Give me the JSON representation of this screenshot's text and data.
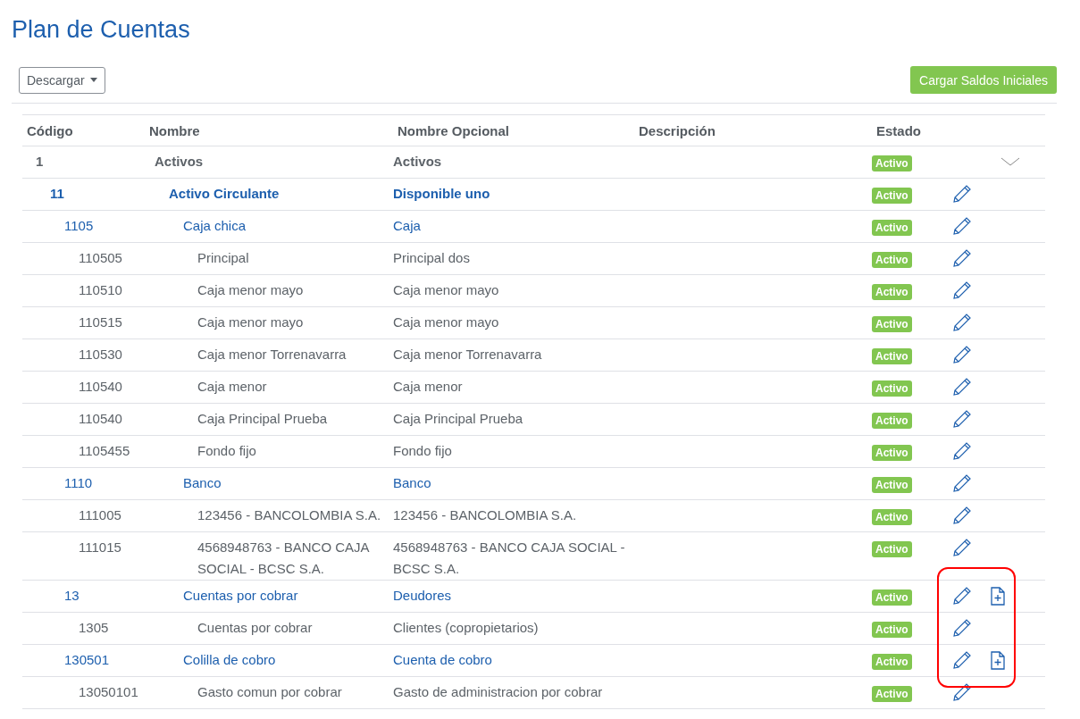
{
  "title": "Plan de Cuentas",
  "toolbar": {
    "download": "Descargar",
    "load_button": "Cargar Saldos Iniciales"
  },
  "table": {
    "columns": [
      "Código",
      "Nombre",
      "Nombre Opcional",
      "Descripción",
      "Estado"
    ],
    "rows": [
      {
        "code": "1",
        "name": "Activos",
        "optional": "Activos",
        "status": "Activo",
        "expanded": true,
        "editable": false,
        "can_add": false,
        "children": [
          {
            "code": "11",
            "name": "Activo Circulante",
            "optional": "Disponible uno",
            "status": "Activo",
            "editable": true,
            "can_add": false,
            "children": [
              {
                "code": "1105",
                "name": "Caja chica",
                "optional": "Caja",
                "status": "Activo",
                "editable": true,
                "can_add": false,
                "children": [
                  {
                    "code": "110505",
                    "name": "Principal",
                    "optional": "Principal dos",
                    "status": "Activo",
                    "editable": true,
                    "can_add": false
                  },
                  {
                    "code": "110510",
                    "name": "Caja menor mayo",
                    "optional": "Caja menor mayo",
                    "status": "Activo",
                    "editable": true,
                    "can_add": false
                  },
                  {
                    "code": "110515",
                    "name": "Caja menor mayo",
                    "optional": "Caja menor mayo",
                    "status": "Activo",
                    "editable": true,
                    "can_add": false
                  },
                  {
                    "code": "110530",
                    "name": "Caja menor Torrenavarra",
                    "optional": "Caja menor Torrenavarra",
                    "status": "Activo",
                    "editable": true,
                    "can_add": false
                  },
                  {
                    "code": "110540",
                    "name": "Caja menor",
                    "optional": "Caja menor",
                    "status": "Activo",
                    "editable": true,
                    "can_add": false
                  },
                  {
                    "code": "110540",
                    "name": "Caja Principal Prueba",
                    "optional": "Caja Principal Prueba",
                    "status": "Activo",
                    "editable": true,
                    "can_add": false
                  },
                  {
                    "code": "1105455",
                    "name": "Fondo fijo",
                    "optional": "Fondo fijo",
                    "status": "Activo",
                    "editable": true,
                    "can_add": false
                  }
                ]
              },
              {
                "code": "1110",
                "name": "Banco",
                "optional": "Banco",
                "status": "Activo",
                "editable": true,
                "can_add": false,
                "children": [
                  {
                    "code": "111005",
                    "name": "123456 - BANCOLOMBIA S.A.",
                    "optional": "123456 - BANCOLOMBIA S.A.",
                    "status": "Activo",
                    "editable": true,
                    "can_add": false
                  },
                  {
                    "code": "111015",
                    "name": "4568948763 - BANCO CAJA SOCIAL - BCSC S.A.",
                    "optional": "4568948763 - BANCO CAJA SOCIAL - BCSC S.A.",
                    "status": "Activo",
                    "editable": true,
                    "can_add": false
                  }
                ]
              },
              {
                "code": "13",
                "name": "Cuentas por cobrar",
                "optional": "Deudores",
                "status": "Activo",
                "editable": true,
                "can_add": true,
                "children": [
                  {
                    "code": "1305",
                    "name": "Cuentas por cobrar",
                    "optional": "Clientes (copropietarios)",
                    "status": "Activo",
                    "editable": true,
                    "can_add": false
                  }
                ]
              },
              {
                "code": "130501",
                "name": "Colilla de cobro",
                "optional": "Cuenta de cobro",
                "status": "Activo",
                "editable": true,
                "can_add": true,
                "children": [
                  {
                    "code": "13050101",
                    "name": "Gasto comun por cobrar",
                    "optional": "Gasto de administracion por cobrar",
                    "status": "Activo",
                    "editable": true,
                    "can_add": false
                  }
                ]
              }
            ]
          }
        ]
      }
    ]
  }
}
